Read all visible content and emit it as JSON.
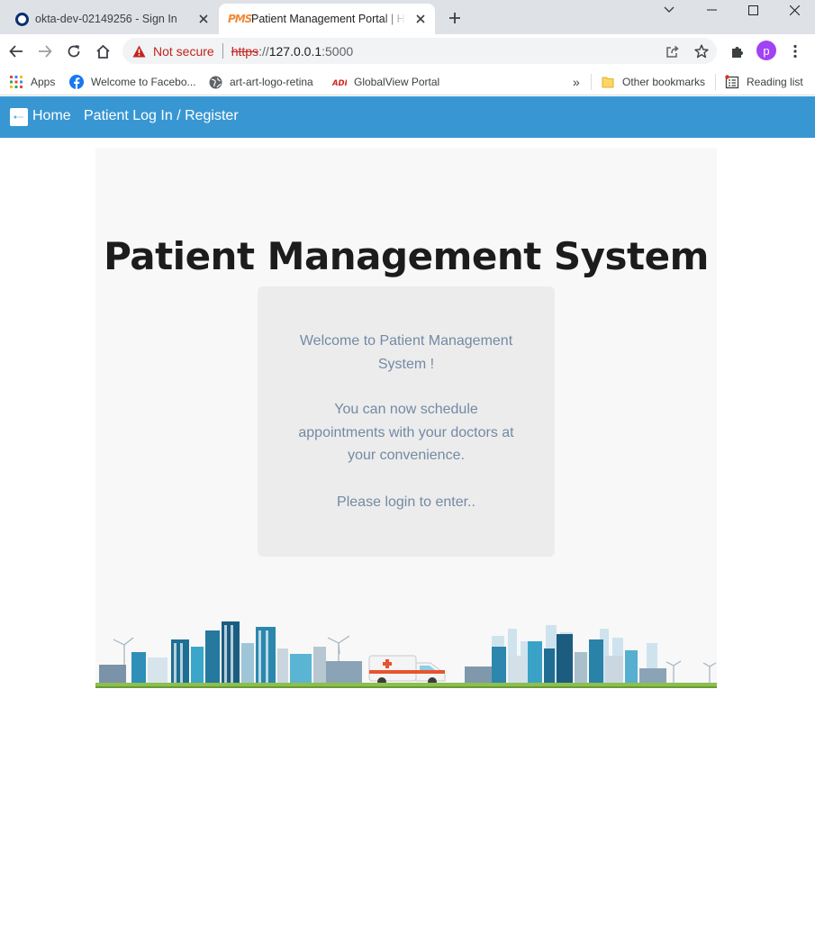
{
  "browser": {
    "tabs": [
      {
        "title": "okta-dev-02149256 - Sign In",
        "active": false,
        "icon": "okta-icon"
      },
      {
        "title": "Patient Management Portal | Home",
        "active": true,
        "icon": "pms-icon",
        "icon_text": "PMS"
      }
    ],
    "url": {
      "security_label": "Not secure",
      "scheme": "https",
      "separator": "://",
      "host": "127.0.0.1",
      "port": ":5000"
    },
    "profile_initial": "p",
    "bookmarks": [
      {
        "label": "Apps",
        "icon": "apps-grid-icon"
      },
      {
        "label": "Welcome to Facebo...",
        "icon": "facebook-icon"
      },
      {
        "label": "art-art-logo-retina",
        "icon": "globe-icon"
      },
      {
        "label": "GlobalView Portal",
        "icon": "adp-icon"
      }
    ],
    "overflow_label": "»",
    "other_bookmarks": "Other bookmarks",
    "reading_list": "Reading list"
  },
  "nav": {
    "home": "Home",
    "login": "Patient Log In / Register"
  },
  "hero": {
    "title": "Patient Management System",
    "welcome": "Welcome to Patient Management System !",
    "schedule": "You can now schedule appointments with your doctors at your convenience.",
    "login_prompt": "Please login to enter.."
  },
  "colors": {
    "navbar": "#3897d3",
    "card_text": "#738aa3",
    "not_secure": "#c5221f",
    "profile": "#a142f4"
  }
}
